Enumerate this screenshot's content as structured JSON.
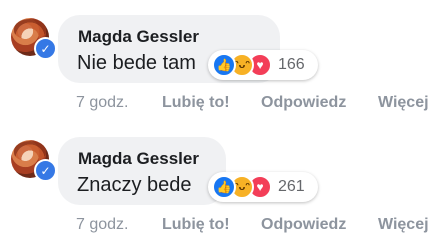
{
  "comments": [
    {
      "author": "Magda Gessler",
      "text": "Nie bede tam",
      "reaction_count": "166",
      "time": "7 godz.",
      "like_label": "Lubię to!",
      "reply_label": "Odpowiedz",
      "more_label": "Więcej",
      "verified": true
    },
    {
      "author": "Magda Gessler",
      "text": "Znaczy bede",
      "reaction_count": "261",
      "time": "7 godz.",
      "like_label": "Lubię to!",
      "reply_label": "Odpowiedz",
      "more_label": "Więcej",
      "verified": true
    }
  ],
  "reaction_icons": [
    "like-icon",
    "haha-icon",
    "love-icon"
  ],
  "colors": {
    "bubble": "#f0f1f3",
    "like": "#1877f2",
    "haha": "#f7b125",
    "love": "#f33e58",
    "verified": "#3578e5",
    "meta_text": "#8d949e"
  }
}
